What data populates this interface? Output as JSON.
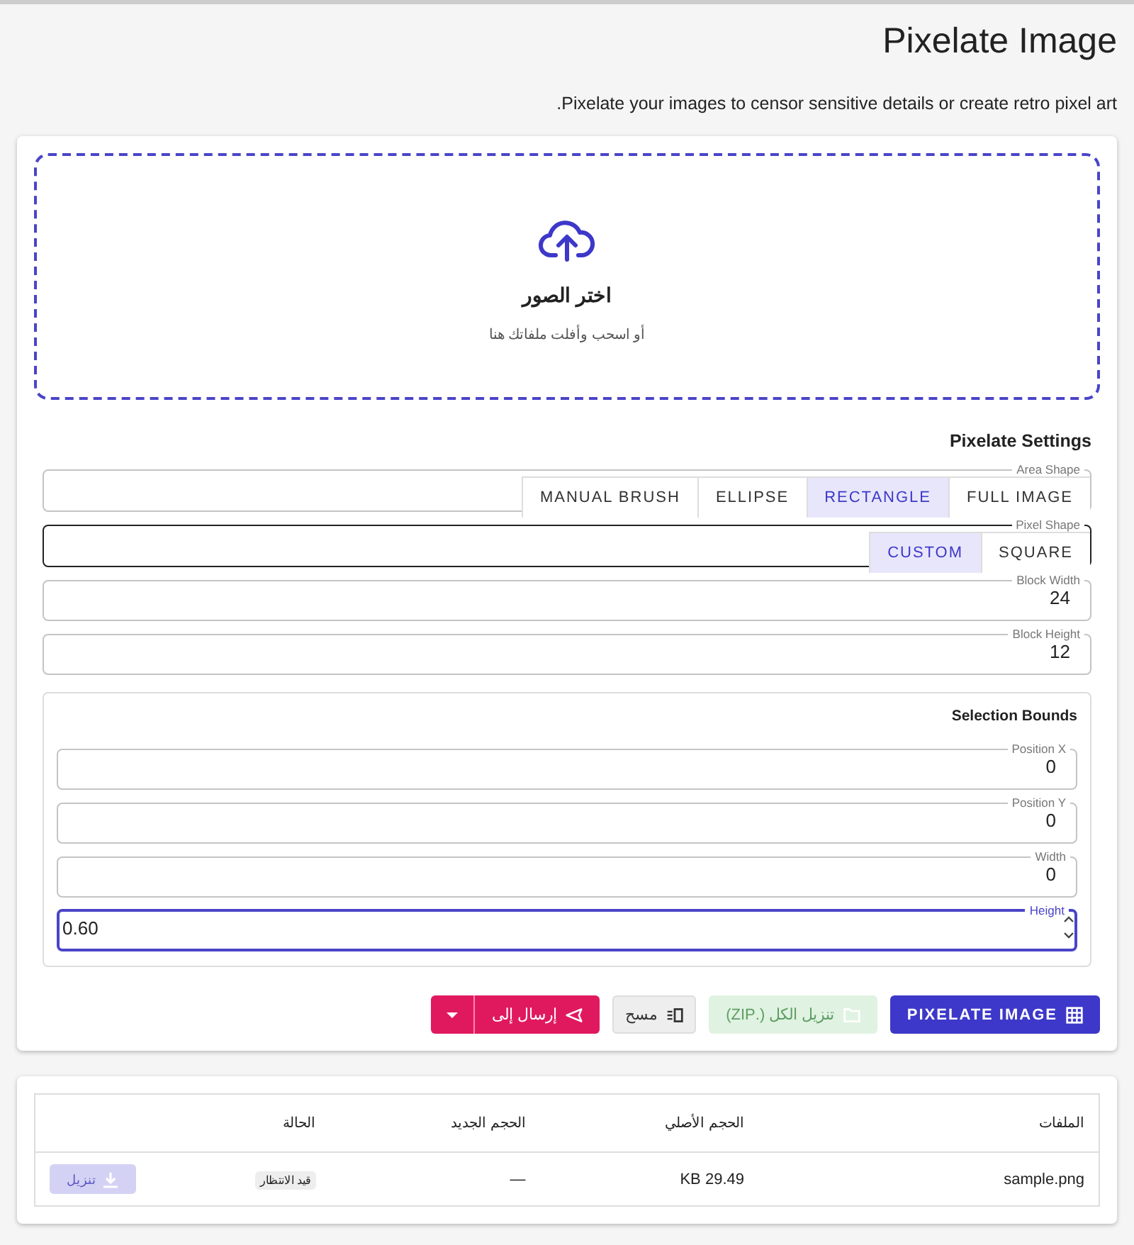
{
  "page": {
    "title": "Pixelate Image",
    "description": "Pixelate your images to censor sensitive details or create retro pixel art."
  },
  "dropzone": {
    "title": "اختر الصور",
    "hint": "أو اسحب وأفلت ملفاتك هنا"
  },
  "settings": {
    "title": "Pixelate Settings",
    "toggles": [
      {
        "label": "Area Shape",
        "hovered": false,
        "options": [
          {
            "label": "FULL IMAGE",
            "selected": false
          },
          {
            "label": "RECTANGLE",
            "selected": true
          },
          {
            "label": "ELLIPSE",
            "selected": false
          },
          {
            "label": "MANUAL BRUSH",
            "selected": false
          }
        ]
      },
      {
        "label": "Pixel Shape",
        "hovered": true,
        "options": [
          {
            "label": "SQUARE",
            "selected": false
          },
          {
            "label": "CUSTOM",
            "selected": true
          }
        ]
      }
    ],
    "fields": [
      {
        "label": "Block Width",
        "value": "24",
        "focused": false
      },
      {
        "label": "Block Height",
        "value": "12",
        "focused": false
      }
    ],
    "bounds": {
      "title": "Selection Bounds",
      "fields": [
        {
          "label": "Position X",
          "value": "0",
          "focused": false
        },
        {
          "label": "Position Y",
          "value": "0",
          "focused": false
        },
        {
          "label": "Width",
          "value": "0",
          "focused": false
        },
        {
          "label": "Height",
          "value": "0.60",
          "focused": true
        }
      ]
    }
  },
  "actions": [
    {
      "kind": "primary",
      "label": "PIXELATE IMAGE",
      "disabled": false
    },
    {
      "kind": "zip",
      "label": "تنزيل الكل (.ZIP)",
      "disabled": true
    },
    {
      "kind": "clear",
      "label": "مسح",
      "disabled": false
    },
    {
      "kind": "send",
      "label": "إرسال إلى",
      "disabled": false
    }
  ],
  "table": {
    "columns": [
      "الملفات",
      "الحجم الأصلي",
      "الحجم الجديد",
      "الحالة"
    ],
    "rows": [
      {
        "file": "sample.png",
        "original": "29.49 KB",
        "new": "—",
        "status": "قيد الانتظار",
        "download": {
          "label": "تنزيل",
          "disabled": true
        }
      }
    ]
  }
}
